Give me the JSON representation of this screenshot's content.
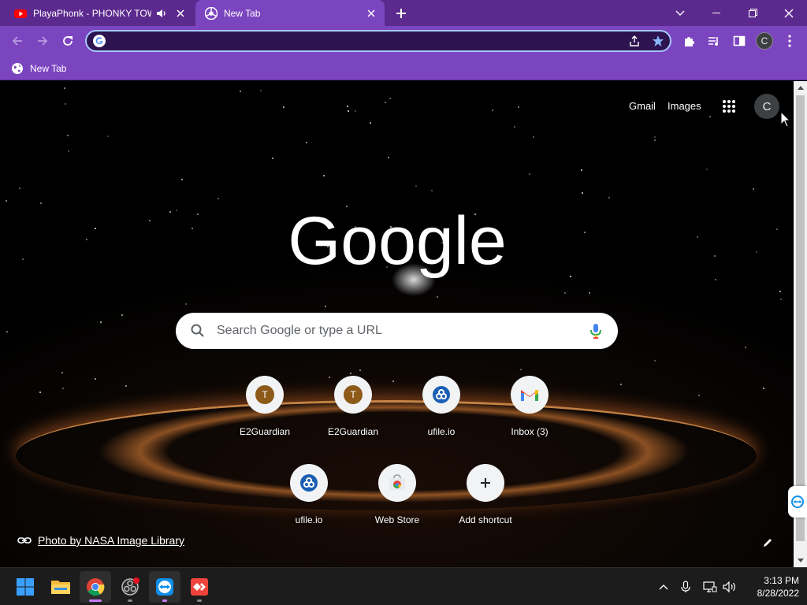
{
  "tabs": [
    {
      "title": "PlayaPhonk - PHONKY TOWN",
      "favicon": "youtube-icon",
      "audio": "speaker-icon",
      "active": false
    },
    {
      "title": "New Tab",
      "favicon": "chrome-icon",
      "active": true
    }
  ],
  "toolbar": {
    "omnibox_value": "",
    "profile_initial": "C"
  },
  "bookmarks": [
    {
      "label": "New Tab",
      "icon": "globe-icon"
    }
  ],
  "ntp": {
    "links": {
      "gmail": "Gmail",
      "images": "Images"
    },
    "account_initial": "C",
    "logo_text": "Google",
    "search_placeholder": "Search Google or type a URL",
    "shortcuts": [
      {
        "label": "E2Guardian",
        "icon": "letter-t-icon",
        "letter": "T"
      },
      {
        "label": "E2Guardian",
        "icon": "letter-t-icon",
        "letter": "T"
      },
      {
        "label": "ufile.io",
        "icon": "ufile-icon"
      },
      {
        "label": "Inbox (3)",
        "icon": "gmail-icon"
      },
      {
        "label": "ufile.io",
        "icon": "ufile-icon"
      },
      {
        "label": "Web Store",
        "icon": "webstore-icon"
      },
      {
        "label": "Add shortcut",
        "icon": "plus-icon"
      }
    ],
    "attribution": "Photo by NASA Image Library"
  },
  "taskbar": {
    "apps": [
      "windows-start-icon",
      "file-explorer-icon",
      "chrome-icon",
      "obs-icon",
      "teamviewer-icon",
      "anydesk-icon"
    ],
    "clock_time": "3:13 PM",
    "clock_date": "8/28/2022"
  },
  "colors": {
    "frame": "#5c2a8e",
    "toolbar": "#7b45c0",
    "omnibox_border": "#a6c8ff"
  }
}
